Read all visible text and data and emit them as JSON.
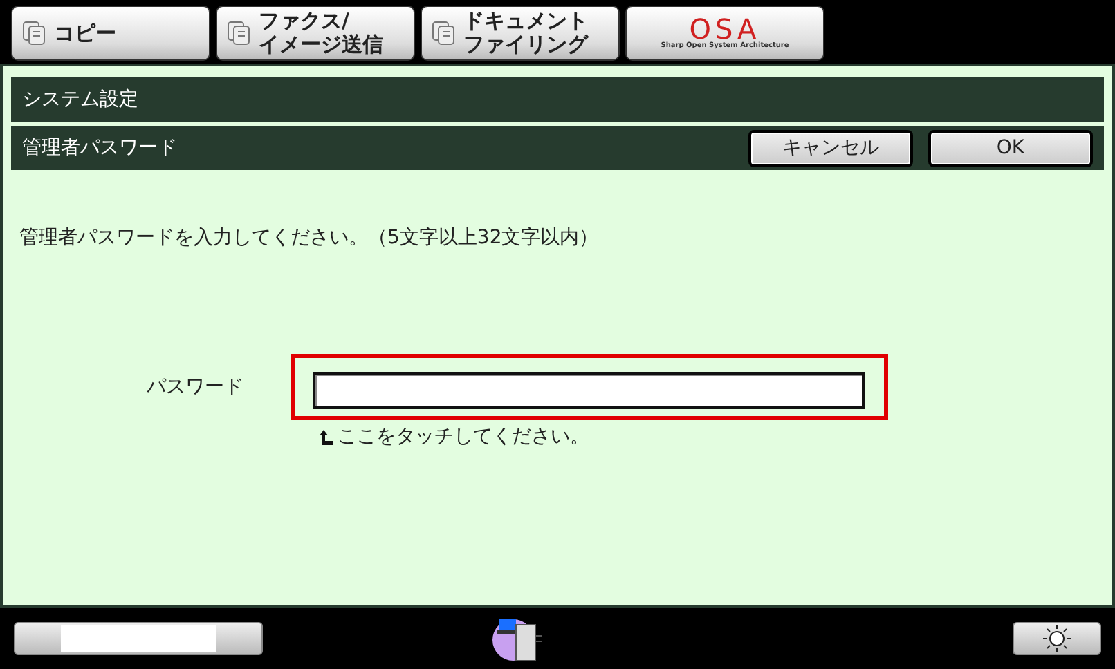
{
  "mode_tabs": [
    {
      "kind": "copy",
      "lines": [
        "コピー"
      ]
    },
    {
      "kind": "fax",
      "lines": [
        "ファクス/",
        "イメージ送信"
      ]
    },
    {
      "kind": "filing",
      "lines": [
        "ドキュメント",
        "ファイリング"
      ]
    },
    {
      "kind": "logo",
      "lines": [
        "OSA"
      ],
      "tagline": "Sharp Open System Architecture"
    }
  ],
  "breadcrumb": "システム設定",
  "dialog": {
    "title": "管理者パスワード",
    "buttons": [
      "キャンセル",
      "OK"
    ]
  },
  "instruction": "管理者パスワードを入力してください。（5文字以上32文字以内）",
  "password": {
    "label": "パスワード",
    "hint": "ここをタッチしてください。"
  }
}
